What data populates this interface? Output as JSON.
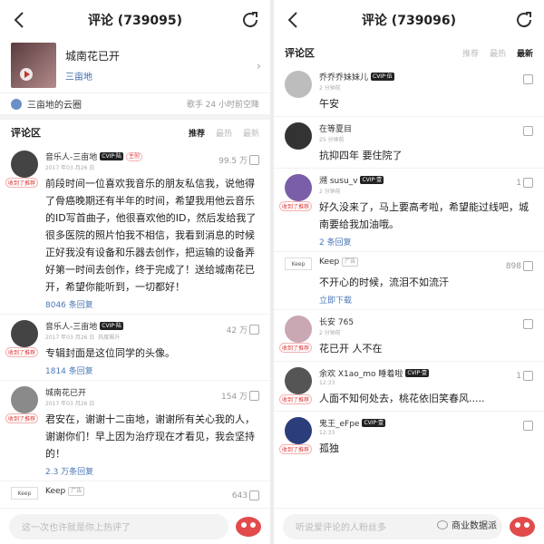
{
  "left": {
    "title": "评论 (739095)",
    "song": {
      "name": "城南花已开",
      "artist": "三亩地"
    },
    "cloud": {
      "label": "三亩地的云圈",
      "right": "歌手 24 小时前空降"
    },
    "section": "评论区",
    "tabs": [
      "推荐",
      "最热",
      "最新"
    ],
    "active_tab": "推荐",
    "comments": [
      {
        "user": "音乐人-三亩地",
        "badge": "CVIP·陆",
        "badge2": "主创",
        "time": "2017 年03 月26 日",
        "likes": "99.5 万",
        "tag": "收到了推荐",
        "text": "前段时间一位喜欢我音乐的朋友私信我，说他得了骨癌晚期还有半年的时间，希望我用他云音乐的ID写首曲子，他很喜欢他的ID，然后发给我了很多医院的照片怕我不相信，我看到消息的时候正好我没有设备和乐器去创作，把运输的设备弄好第一时间去创作，终于完成了！送给城南花已开，希望你能听到，一切都好！",
        "link": "8046 条回复"
      },
      {
        "user": "音乐人-三亩地",
        "badge": "CVIP·陆",
        "badge2": "",
        "time": "2017 年03 月26 日",
        "hot": "热度飙升",
        "likes": "42 万",
        "tag": "收到了推荐",
        "text": "专辑封面是这位同学的头像。",
        "link": "1814 条回复"
      },
      {
        "user": "城南花已开",
        "badge": "",
        "badge2": "",
        "time": "2017 年03 月26 日",
        "likes": "154 万",
        "tag": "收到了推荐",
        "text": "君安在，谢谢十二亩地，谢谢所有关心我的人，谢谢你们！早上因为治疗现在才看见，我会坚持的！",
        "link": "2.3 万条回复"
      },
      {
        "user": "Keep",
        "ad": "广告",
        "likes": "643",
        "logo": "Keep"
      }
    ],
    "input_placeholder": "这一次也许就是你上热评了"
  },
  "right": {
    "title": "评论 (739096)",
    "section": "评论区",
    "tabs": [
      "推荐",
      "最热",
      "最新"
    ],
    "active_tab": "最新",
    "comments": [
      {
        "user": "乔乔乔妹妹儿",
        "badge": "CVIP·伍",
        "time": "2 分钟前",
        "likes": "",
        "text": "午安"
      },
      {
        "user": "在等夏目",
        "badge": "",
        "time": "25 分钟前",
        "likes": "",
        "text": "抗抑四年 要住院了"
      },
      {
        "user": "溯 susu_v",
        "badge": "CVIP·壹",
        "time": "2 分钟前",
        "likes": "1",
        "tag": "收到了推荐",
        "text": "好久没来了，马上要高考啦，希望能过线吧，城南要给我加油哦。",
        "link": "2 条回复"
      },
      {
        "user": "Keep",
        "ad": "广告",
        "time": "",
        "likes": "898",
        "logo": "Keep",
        "text": "不开心的时候，流泪不如流汗",
        "link": "立即下载"
      },
      {
        "user": "长安 765",
        "badge": "",
        "time": "2 分钟前",
        "likes": "",
        "tag": "收到了推荐",
        "text": "花已开 人不在"
      },
      {
        "user": "余欢 X1ao_mo 睡着啦",
        "badge": "CVIP·壹",
        "time": "12:33",
        "likes": "1",
        "tag": "收到了推荐",
        "text": "人面不知何处去，桃花依旧笑春风....."
      },
      {
        "user": "鬼王_eFpe",
        "badge": "CVIP·壹",
        "time": "12:33",
        "likes": "",
        "tag": "收到了推荐",
        "text": "孤独"
      }
    ],
    "input_placeholder": "听说爱评论的人粉丝多",
    "watermark": "商业数据派"
  }
}
